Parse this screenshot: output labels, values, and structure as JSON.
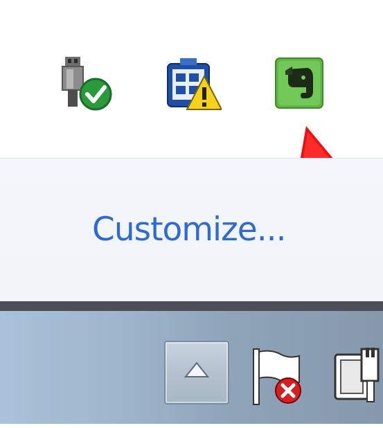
{
  "notification_flyout": {
    "icons": [
      {
        "name": "safely-remove-hardware-icon"
      },
      {
        "name": "network-warning-icon"
      },
      {
        "name": "evernote-icon"
      }
    ],
    "customize_label": "Customize..."
  },
  "taskbar": {
    "tray_icons": [
      {
        "name": "show-hidden-icons-button"
      },
      {
        "name": "action-center-flag-error-icon"
      },
      {
        "name": "power-plug-icon"
      }
    ]
  },
  "colors": {
    "link": "#2d6ad8",
    "arrow": "#ee1111",
    "evernote_green": "#5eb843"
  }
}
